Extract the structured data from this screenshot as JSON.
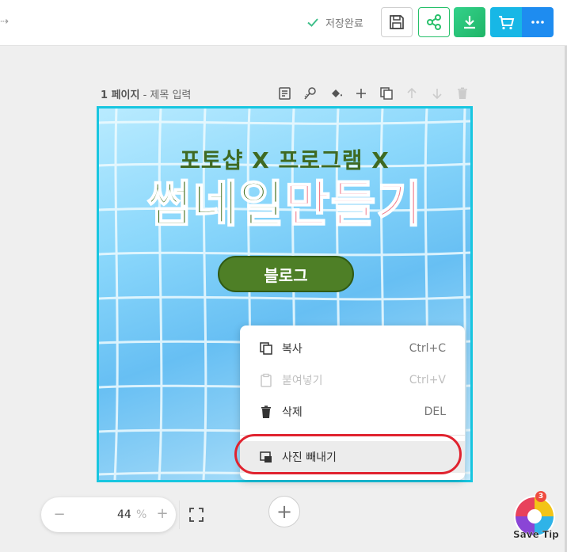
{
  "topbar": {
    "save_status": "저장완료",
    "buttons": [
      "save-icon",
      "share-icon",
      "download-icon",
      "cart-icon",
      "more-icon"
    ]
  },
  "page": {
    "number": "1 페이지",
    "separator": " - ",
    "title_placeholder": "제목 입력"
  },
  "canvas": {
    "headline1": "포토샵 X 프로그램 X",
    "headline2_part1": "썸네일",
    "headline2_part2": "만들기",
    "pill_text": "블로그"
  },
  "context_menu": {
    "items": [
      {
        "label": "복사",
        "shortcut": "Ctrl+C",
        "icon": "copy-icon",
        "enabled": true
      },
      {
        "label": "붙여넣기",
        "shortcut": "Ctrl+V",
        "icon": "clipboard-icon",
        "enabled": false
      },
      {
        "label": "삭제",
        "shortcut": "DEL",
        "icon": "trash-icon",
        "enabled": true
      },
      {
        "label": "사진 빼내기",
        "shortcut": "",
        "icon": "extract-photo-icon",
        "enabled": true
      }
    ]
  },
  "zoom": {
    "value": "44",
    "unit": "%",
    "minus": "−",
    "plus": "+"
  },
  "add_page": "+",
  "watermark": {
    "text": "Save Tip",
    "badge": "3"
  },
  "colors": {
    "canvas_border": "#18c6e0",
    "highlight_ring": "#e0232f",
    "share_green": "#27c06a",
    "cart_blue": "#17b7e6",
    "more_blue": "#1e8cf0"
  }
}
